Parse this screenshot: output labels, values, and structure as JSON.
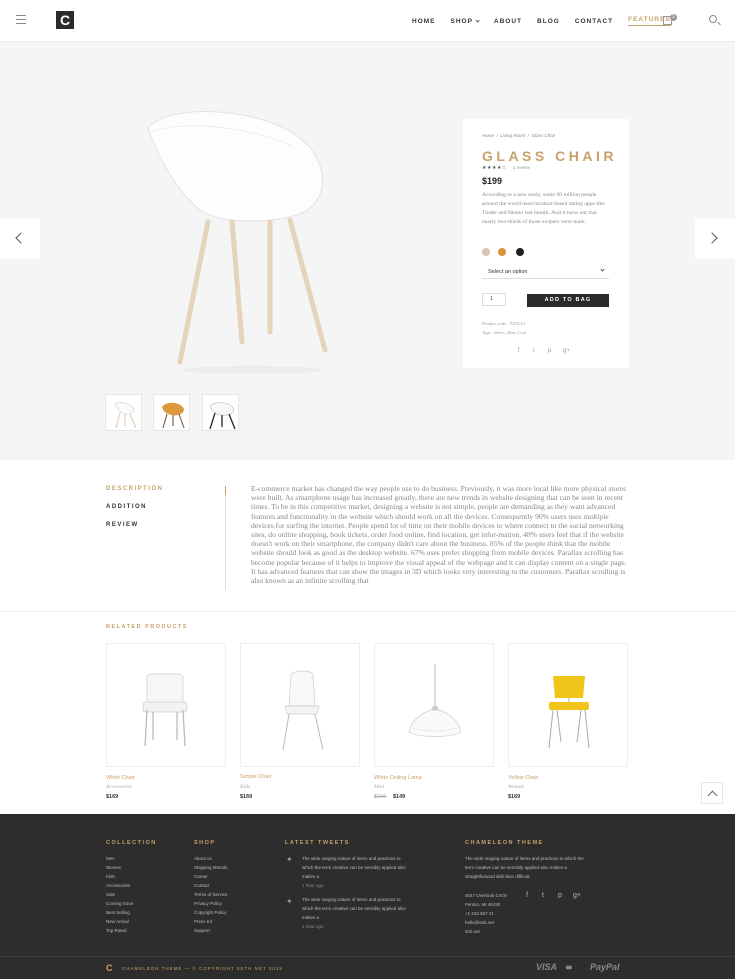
{
  "header": {
    "logo_letter": "C",
    "nav": [
      {
        "label": "HOME"
      },
      {
        "label": "SHOP"
      },
      {
        "label": "ABOUT"
      },
      {
        "label": "BLOG"
      },
      {
        "label": "CONTACT"
      },
      {
        "label": "FEATURES"
      }
    ],
    "cart_count": "1"
  },
  "product": {
    "breadcrumb": [
      "Home",
      "Living Room",
      "Glass Chair"
    ],
    "title": "GLASS CHAIR",
    "stars": "★★★★☆",
    "reviews": "1 review",
    "price": "$199",
    "description": "According to a new study, some 90 million people around the world used location-based dating apps like Tinder and Momo last month. And it turns out that nearly two-thirds of those swipers were male.",
    "swatches": [
      "#d9c4b3",
      "#d9913a",
      "#1f1f1f"
    ],
    "select_placeholder": "Select an option",
    "quantity": "1",
    "add_button": "ADD TO BAG",
    "product_code": "Product code : P234,13",
    "tags": "Tags : Shoes, Man, Cool",
    "social": [
      "f",
      "t",
      "p",
      "g+"
    ]
  },
  "details": {
    "tabs": [
      "DESCRIPTION",
      "ADDITION",
      "REVIEW"
    ],
    "text": "E-commerce market has changed the way people use to do business. Previously, it was more local like more physical stores were built. As smartphone usage has increased greatly, there are new trends in website designing that can be seen in recent times. To be in this competitive market, designing a website is not simple, people are demanding as they want advanced features and functionality in the website which should work on all the devices. Consequently 90% users uses multiple devices for surfing the internet. People spend lot of time on their mobile devices to where connect to the social networking sites, do online shopping, book tickets, order food online, find location, get infor-mation. 48% users feel that if the website doesn't work on their smartphone, the company didn't care about the business. 85% of the people think that the mobile website should look as good as the desktop website. 67% uses prefer shopping from mobile devices. Parallax scrolling has become popular because of it helps to improve the visual appeal of the webpage and it can display content on a single page. It has advanced features that can show the images in 3D which looks very interesting to the customers. Parallax scrolling is also known as an infinite scrolling that"
  },
  "related": {
    "title": "RELATED PRODUCTS",
    "items": [
      {
        "name": "White Chair",
        "category": "Accessories",
        "price": "$169",
        "old_price": ""
      },
      {
        "name": "Simple Chair",
        "category": "Kids",
        "price": "$169",
        "old_price": ""
      },
      {
        "name": "White Ceiling Lamp",
        "category": "Man",
        "price": "$149",
        "old_price": "$169"
      },
      {
        "name": "Yellow Chair",
        "category": "Woman",
        "price": "$169",
        "old_price": ""
      }
    ]
  },
  "footer": {
    "collection_title": "COLLECTION",
    "collection": [
      "Men",
      "Women",
      "Kids",
      "Accessories",
      "Sale",
      "Coming Soon",
      "Best Selling",
      "New Arrival",
      "Top Rated"
    ],
    "shop_title": "SHOP",
    "shop": [
      "About us",
      "Shipping Metods",
      "Career",
      "Contact",
      "Terms of Service",
      "Privacy Policy",
      "Copyright Policy",
      "Press Kit",
      "Support"
    ],
    "tweets_title": "LATEST TWEETS",
    "tweets": [
      {
        "text": "The wide ranging nature of items and practices to which the term creative can be sensibly applied also makes a",
        "time": "1 hour ago"
      },
      {
        "text": "The wide ranging nature of items and practices to which the term creative can be sensibly applied also makes a",
        "time": "1 hour ago"
      }
    ],
    "about_title": "CHAMELEON THEME",
    "about_text": "The wide ranging nature of items and practices to which the term creative can be sensibly applied also makes a straightforward definition difficult.",
    "contact": [
      "4047 Overlook Circle",
      "Fenton, MI 48430",
      "+1 234 567 21",
      "hello@5sh.net",
      "5sh.net"
    ],
    "social": [
      "f",
      "t",
      "p",
      "g+"
    ],
    "copyright": "CHAMELEON THEME — © COPYRIGHT 5STH NET 2015",
    "payments": [
      "VISA",
      "●●",
      "PayPal"
    ]
  }
}
